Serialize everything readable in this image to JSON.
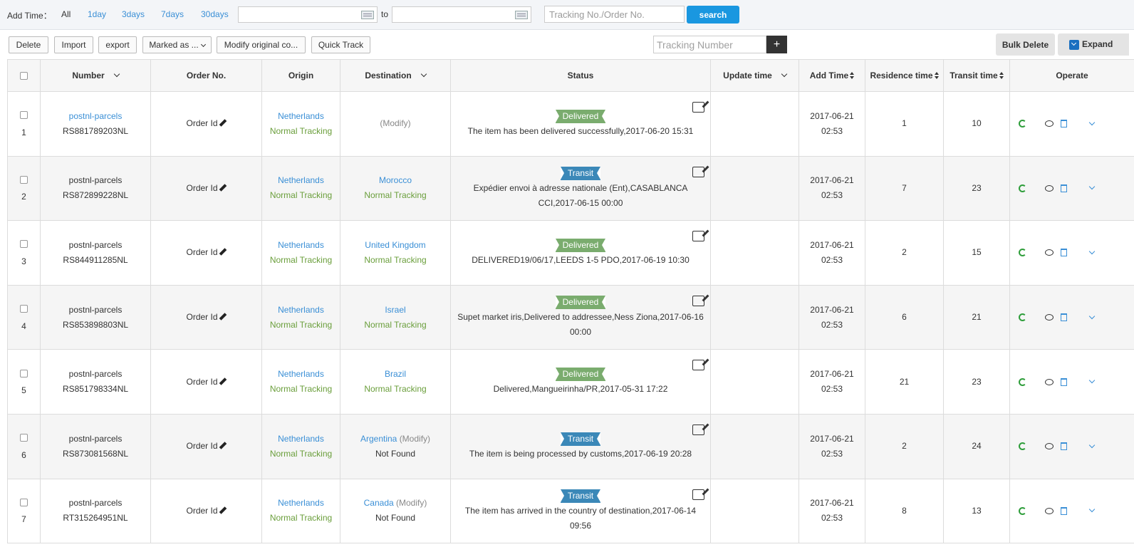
{
  "filter": {
    "label": "Add Time：",
    "ranges": [
      "All",
      "1day",
      "3days",
      "7days",
      "30days"
    ],
    "to_label": "to",
    "search_placeholder": "Tracking No./Order No.",
    "search_button": "search"
  },
  "toolbar": {
    "delete": "Delete",
    "import": "Import",
    "export": "export",
    "marked_as": "Marked as ...",
    "modify_original": "Modify original co...",
    "quick_track": "Quick Track",
    "tracking_placeholder": "Tracking Number",
    "plus": "+",
    "bulk_delete": "Bulk Delete",
    "expand": "Expand"
  },
  "table": {
    "headers": {
      "number": "Number",
      "order_no": "Order No.",
      "origin": "Origin",
      "destination": "Destination",
      "status": "Status",
      "update_time": "Update time",
      "add_time": "Add Time",
      "residence_time": "Residence time",
      "transit_time": "Transit time",
      "operate": "Operate"
    },
    "rows": [
      {
        "index": "1",
        "carrier": "postnl-parcels",
        "tracking": "RS881789203NL",
        "order": "Order Id",
        "origin_country": "Netherlands",
        "origin_tracking": "Normal Tracking",
        "dest_country": "",
        "dest_modify": "(Modify)",
        "dest_tracking": "",
        "status": "Delivered",
        "status_text": "The item has been delivered successfully,2017-06-20 15:31",
        "update_time": "",
        "add_date": "2017-06-21",
        "add_clock": "02:53",
        "residence": "1",
        "transit": "10"
      },
      {
        "index": "2",
        "carrier": "postnl-parcels",
        "tracking": "RS872899228NL",
        "order": "Order Id",
        "origin_country": "Netherlands",
        "origin_tracking": "Normal Tracking",
        "dest_country": "Morocco",
        "dest_modify": "",
        "dest_tracking": "Normal Tracking",
        "status": "Transit",
        "status_text": "Expédier envoi à adresse nationale (Ent),CASABLANCA CCI,2017-06-15 00:00",
        "update_time": "",
        "add_date": "2017-06-21",
        "add_clock": "02:53",
        "residence": "7",
        "transit": "23"
      },
      {
        "index": "3",
        "carrier": "postnl-parcels",
        "tracking": "RS844911285NL",
        "order": "Order Id",
        "origin_country": "Netherlands",
        "origin_tracking": "Normal Tracking",
        "dest_country": "United Kingdom",
        "dest_modify": "",
        "dest_tracking": "Normal Tracking",
        "status": "Delivered",
        "status_text": "DELIVERED19/06/17,LEEDS 1-5 PDO,2017-06-19 10:30",
        "update_time": "",
        "add_date": "2017-06-21",
        "add_clock": "02:53",
        "residence": "2",
        "transit": "15"
      },
      {
        "index": "4",
        "carrier": "postnl-parcels",
        "tracking": "RS853898803NL",
        "order": "Order Id",
        "origin_country": "Netherlands",
        "origin_tracking": "Normal Tracking",
        "dest_country": "Israel",
        "dest_modify": "",
        "dest_tracking": "Normal Tracking",
        "status": "Delivered",
        "status_text": "Supet market iris,Delivered to addressee,Ness Ziona,2017-06-16 00:00",
        "update_time": "",
        "add_date": "2017-06-21",
        "add_clock": "02:53",
        "residence": "6",
        "transit": "21"
      },
      {
        "index": "5",
        "carrier": "postnl-parcels",
        "tracking": "RS851798334NL",
        "order": "Order Id",
        "origin_country": "Netherlands",
        "origin_tracking": "Normal Tracking",
        "dest_country": "Brazil",
        "dest_modify": "",
        "dest_tracking": "Normal Tracking",
        "status": "Delivered",
        "status_text": "Delivered,Mangueirinha/PR,2017-05-31 17:22",
        "update_time": "",
        "add_date": "2017-06-21",
        "add_clock": "02:53",
        "residence": "21",
        "transit": "23"
      },
      {
        "index": "6",
        "carrier": "postnl-parcels",
        "tracking": "RS873081568NL",
        "order": "Order Id",
        "origin_country": "Netherlands",
        "origin_tracking": "Normal Tracking",
        "dest_country": "Argentina",
        "dest_modify": "(Modify)",
        "dest_tracking": "Not Found",
        "status": "Transit",
        "status_text": "The item is being processed by customs,2017-06-19 20:28",
        "update_time": "",
        "add_date": "2017-06-21",
        "add_clock": "02:53",
        "residence": "2",
        "transit": "24"
      },
      {
        "index": "7",
        "carrier": "postnl-parcels",
        "tracking": "RT315264951NL",
        "order": "Order Id",
        "origin_country": "Netherlands",
        "origin_tracking": "Normal Tracking",
        "dest_country": "Canada",
        "dest_modify": "(Modify)",
        "dest_tracking": "Not Found",
        "status": "Transit",
        "status_text": "The item has arrived in the country of destination,2017-06-14 09:56",
        "update_time": "",
        "add_date": "2017-06-21",
        "add_clock": "02:53",
        "residence": "8",
        "transit": "13"
      }
    ]
  },
  "colors": {
    "delivered": "#7aac6e",
    "transit": "#3b88b8",
    "link_blue": "#3a8fd6",
    "tracking_green": "#6a9e3b",
    "search_button": "#1a97e0"
  },
  "icons": {
    "calendar": "calendar-icon",
    "edit": "edit-icon",
    "pencil": "pencil-icon",
    "refresh": "refresh-icon",
    "comment": "comment-icon",
    "trash": "trash-icon",
    "chevron": "chevron-down-icon",
    "sort": "sort-icon"
  }
}
